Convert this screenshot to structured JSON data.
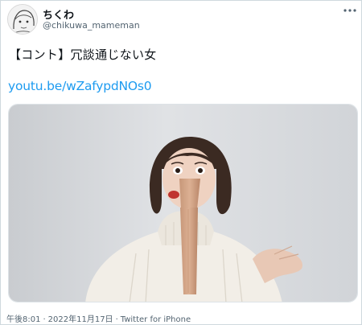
{
  "author": {
    "display_name": "ちくわ",
    "handle": "@chikuwa_mameman",
    "avatar_icon": "avatar-sketch-icon"
  },
  "tweet": {
    "text": "【コント】冗談通じない女",
    "link": "youtu.be/wZafypdNOs0"
  },
  "meta": {
    "time": "午後8:01",
    "separator": "·",
    "date": "2022年11月17日",
    "source": "Twitter for iPhone"
  },
  "icons": {
    "more": "more-options-icon"
  },
  "colors": {
    "link": "#1d9bf0",
    "text": "#0f1419",
    "secondary": "#536471"
  }
}
